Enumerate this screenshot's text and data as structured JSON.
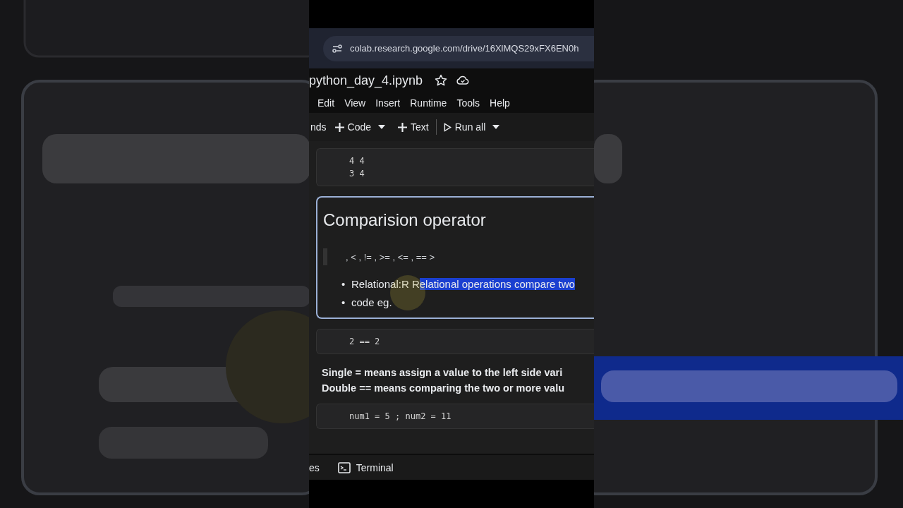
{
  "browser": {
    "url": "colab.research.google.com/drive/16XlMQS29xFX6EN0h"
  },
  "notebook": {
    "title": "python_day_4.ipynb",
    "starred": false
  },
  "menu": [
    "Edit",
    "View",
    "Insert",
    "Runtime",
    "Tools",
    "Help"
  ],
  "toolbar": {
    "commands_label": "nds",
    "code_button": "Code",
    "text_button": "Text",
    "run_all_button": "Run all"
  },
  "cells": [
    {
      "kind": "output",
      "lines": [
        "4 4",
        "3 4"
      ]
    },
    {
      "kind": "markdown",
      "selected": true,
      "heading": "Comparision operator",
      "quote": ", < , != , >= , <= , == >",
      "bullets": [
        {
          "marker": "•",
          "text": "Relational:R R",
          "highlight": "elational operations compare two"
        },
        {
          "marker": "•",
          "text": "code eg."
        }
      ]
    },
    {
      "kind": "code",
      "lines": [
        "2 == 2"
      ]
    },
    {
      "kind": "text",
      "lines": [
        "Single = means assign a value to the left side vari",
        "Double == means comparing the two or more valu"
      ]
    },
    {
      "kind": "code",
      "lines": [
        "num1 = 5 ; num2 = 11"
      ]
    }
  ],
  "bottom_bar": {
    "files_label": "es",
    "terminal_label": "Terminal"
  }
}
